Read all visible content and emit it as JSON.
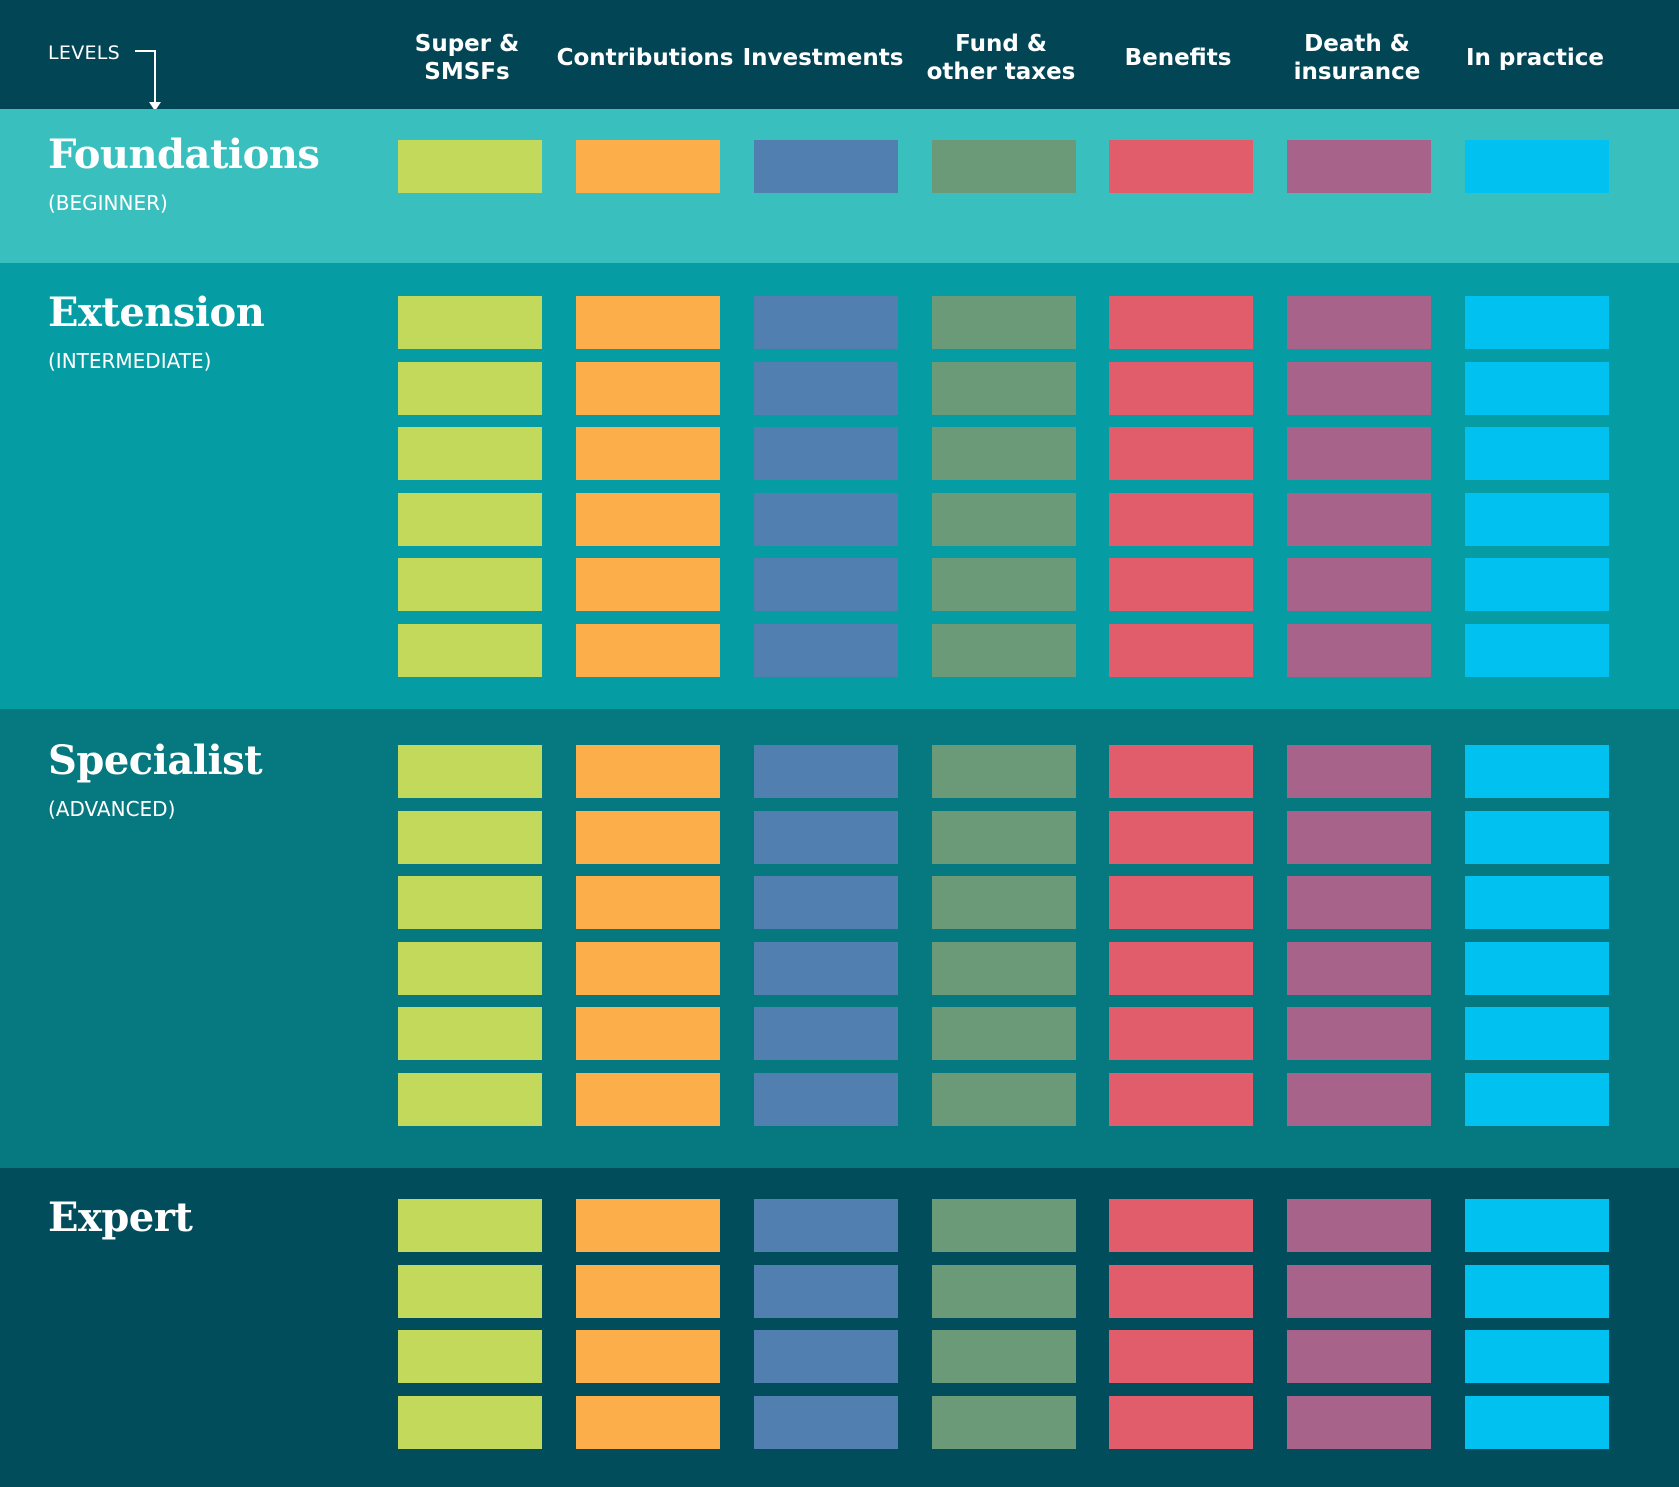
{
  "header": {
    "levels_label": "LEVELS",
    "columns": [
      {
        "label": "Super &\nSMSFs",
        "color": "#c2d95b"
      },
      {
        "label": "Contributions",
        "color": "#fbae4a"
      },
      {
        "label": "Investments",
        "color": "#507fb0"
      },
      {
        "label": "Fund &\nother taxes",
        "color": "#6b9a78"
      },
      {
        "label": "Benefits",
        "color": "#e15d6b"
      },
      {
        "label": "Death &\ninsurance",
        "color": "#a8638a"
      },
      {
        "label": "In practice",
        "color": "#00c1f0"
      }
    ]
  },
  "levels": [
    {
      "name": "Foundations",
      "subtitle": "(BEGINNER)",
      "modules_per_topic": 1,
      "background": "#3abfbf"
    },
    {
      "name": "Extension",
      "subtitle": "(INTERMEDIATE)",
      "modules_per_topic": 6,
      "background": "#069ca4"
    },
    {
      "name": "Specialist",
      "subtitle": "(ADVANCED)",
      "modules_per_topic": 6,
      "background": "#067880"
    },
    {
      "name": "Expert",
      "subtitle": "",
      "modules_per_topic": 4,
      "background": "#024d5b"
    }
  ]
}
